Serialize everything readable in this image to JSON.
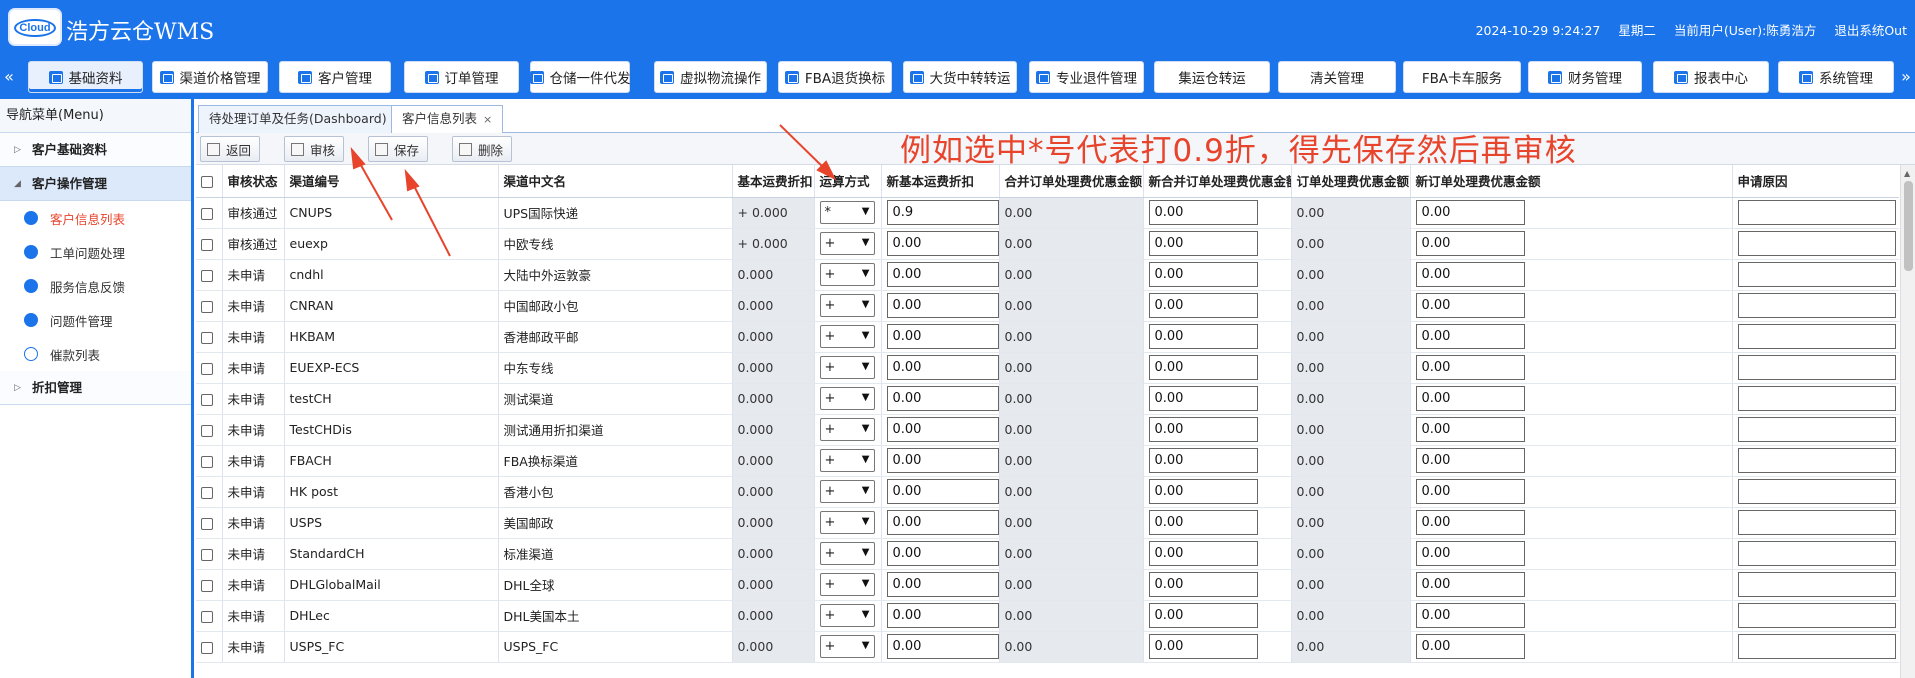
{
  "app": {
    "logo_text": "Cloud",
    "title": "浩方云仓WMS"
  },
  "header": {
    "datetime": "2024-10-29 9:24:27",
    "weekday": "星期二",
    "current_user": "当前用户(User):陈勇浩方",
    "logout": "退出系统Out"
  },
  "nav": {
    "prev": "«",
    "next": "»",
    "items": [
      {
        "label": "基础资料",
        "active": true
      },
      {
        "label": "渠道价格管理"
      },
      {
        "label": "客户管理"
      },
      {
        "label": "订单管理"
      },
      {
        "label": "仓储一件代发"
      },
      {
        "label": "虚拟物流操作"
      },
      {
        "label": "FBA退货换标"
      },
      {
        "label": "大货中转转运"
      },
      {
        "label": "专业退件管理"
      },
      {
        "label": "集运仓转运"
      },
      {
        "label": "清关管理"
      },
      {
        "label": "FBA卡车服务"
      },
      {
        "label": "财务管理"
      },
      {
        "label": "报表中心"
      },
      {
        "label": "系统管理"
      }
    ]
  },
  "sidebar": {
    "title": "导航菜单(Menu)",
    "group_basic": "客户基础资料",
    "group_ops": "客户操作管理",
    "items": [
      "客户信息列表",
      "工单问题处理",
      "服务信息反馈",
      "问题件管理",
      "催款列表"
    ],
    "group_discount": "折扣管理"
  },
  "tabs": {
    "dashboard": "待处理订单及任务(Dashboard)",
    "customer": "客户信息列表",
    "close": "×"
  },
  "toolbar": {
    "back": "返回",
    "audit": "审核",
    "save": "保存",
    "delete": "删除"
  },
  "annotation": "例如选中*号代表打0.9折，得先保存然后再审核",
  "table": {
    "columns": [
      "审核状态",
      "渠道编号",
      "渠道中文名",
      "基本运费折扣",
      "运算方式",
      "新基本运费折扣",
      "合并订单处理费优惠金额",
      "新合并订单处理费优惠金额",
      "订单处理费优惠金额",
      "新订单处理费优惠金额",
      "申请原因"
    ],
    "rows": [
      {
        "status": "审核通过",
        "code": "CNUPS",
        "name": "UPS国际快递",
        "base": "+ 0.000",
        "op": "*",
        "new_base": "0.9",
        "merge": "0.00",
        "new_merge": "0.00",
        "order": "0.00",
        "new_order": "0.00"
      },
      {
        "status": "审核通过",
        "code": "euexp",
        "name": "中欧专线",
        "base": "+ 0.000",
        "op": "+",
        "new_base": "0.00",
        "merge": "0.00",
        "new_merge": "0.00",
        "order": "0.00",
        "new_order": "0.00"
      },
      {
        "status": "未申请",
        "code": "cndhl",
        "name": "大陆中外运敦豪",
        "base": "0.000",
        "op": "+",
        "new_base": "0.00",
        "merge": "0.00",
        "new_merge": "0.00",
        "order": "0.00",
        "new_order": "0.00"
      },
      {
        "status": "未申请",
        "code": "CNRAN",
        "name": "中国邮政小包",
        "base": "0.000",
        "op": "+",
        "new_base": "0.00",
        "merge": "0.00",
        "new_merge": "0.00",
        "order": "0.00",
        "new_order": "0.00"
      },
      {
        "status": "未申请",
        "code": "HKBAM",
        "name": "香港邮政平邮",
        "base": "0.000",
        "op": "+",
        "new_base": "0.00",
        "merge": "0.00",
        "new_merge": "0.00",
        "order": "0.00",
        "new_order": "0.00"
      },
      {
        "status": "未申请",
        "code": "EUEXP-ECS",
        "name": "中东专线",
        "base": "0.000",
        "op": "+",
        "new_base": "0.00",
        "merge": "0.00",
        "new_merge": "0.00",
        "order": "0.00",
        "new_order": "0.00"
      },
      {
        "status": "未申请",
        "code": "testCH",
        "name": "测试渠道",
        "base": "0.000",
        "op": "+",
        "new_base": "0.00",
        "merge": "0.00",
        "new_merge": "0.00",
        "order": "0.00",
        "new_order": "0.00"
      },
      {
        "status": "未申请",
        "code": "TestCHDis",
        "name": "测试通用折扣渠道",
        "base": "0.000",
        "op": "+",
        "new_base": "0.00",
        "merge": "0.00",
        "new_merge": "0.00",
        "order": "0.00",
        "new_order": "0.00"
      },
      {
        "status": "未申请",
        "code": "FBACH",
        "name": "FBA换标渠道",
        "base": "0.000",
        "op": "+",
        "new_base": "0.00",
        "merge": "0.00",
        "new_merge": "0.00",
        "order": "0.00",
        "new_order": "0.00"
      },
      {
        "status": "未申请",
        "code": "HK post",
        "name": "香港小包",
        "base": "0.000",
        "op": "+",
        "new_base": "0.00",
        "merge": "0.00",
        "new_merge": "0.00",
        "order": "0.00",
        "new_order": "0.00"
      },
      {
        "status": "未申请",
        "code": "USPS",
        "name": "美国邮政",
        "base": "0.000",
        "op": "+",
        "new_base": "0.00",
        "merge": "0.00",
        "new_merge": "0.00",
        "order": "0.00",
        "new_order": "0.00"
      },
      {
        "status": "未申请",
        "code": "StandardCH",
        "name": "标准渠道",
        "base": "0.000",
        "op": "+",
        "new_base": "0.00",
        "merge": "0.00",
        "new_merge": "0.00",
        "order": "0.00",
        "new_order": "0.00"
      },
      {
        "status": "未申请",
        "code": "DHLGlobalMail",
        "name": "DHL全球",
        "base": "0.000",
        "op": "+",
        "new_base": "0.00",
        "merge": "0.00",
        "new_merge": "0.00",
        "order": "0.00",
        "new_order": "0.00"
      },
      {
        "status": "未申请",
        "code": "DHLec",
        "name": "DHL美国本土",
        "base": "0.000",
        "op": "+",
        "new_base": "0.00",
        "merge": "0.00",
        "new_merge": "0.00",
        "order": "0.00",
        "new_order": "0.00"
      },
      {
        "status": "未申请",
        "code": "USPS_FC",
        "name": "USPS_FC",
        "base": "0.000",
        "op": "+",
        "new_base": "0.00",
        "merge": "0.00",
        "new_merge": "0.00",
        "order": "0.00",
        "new_order": "0.00"
      }
    ]
  },
  "colors": {
    "accent": "#1b74ea",
    "annotation": "#e8442c"
  },
  "icons": [
    "tag-icon",
    "user-icon",
    "list-icon",
    "warehouse-icon",
    "box-icon",
    "truck-icon",
    "database-icon",
    "gear-icon",
    "users-icon",
    "question-icon",
    "dollar-icon"
  ]
}
